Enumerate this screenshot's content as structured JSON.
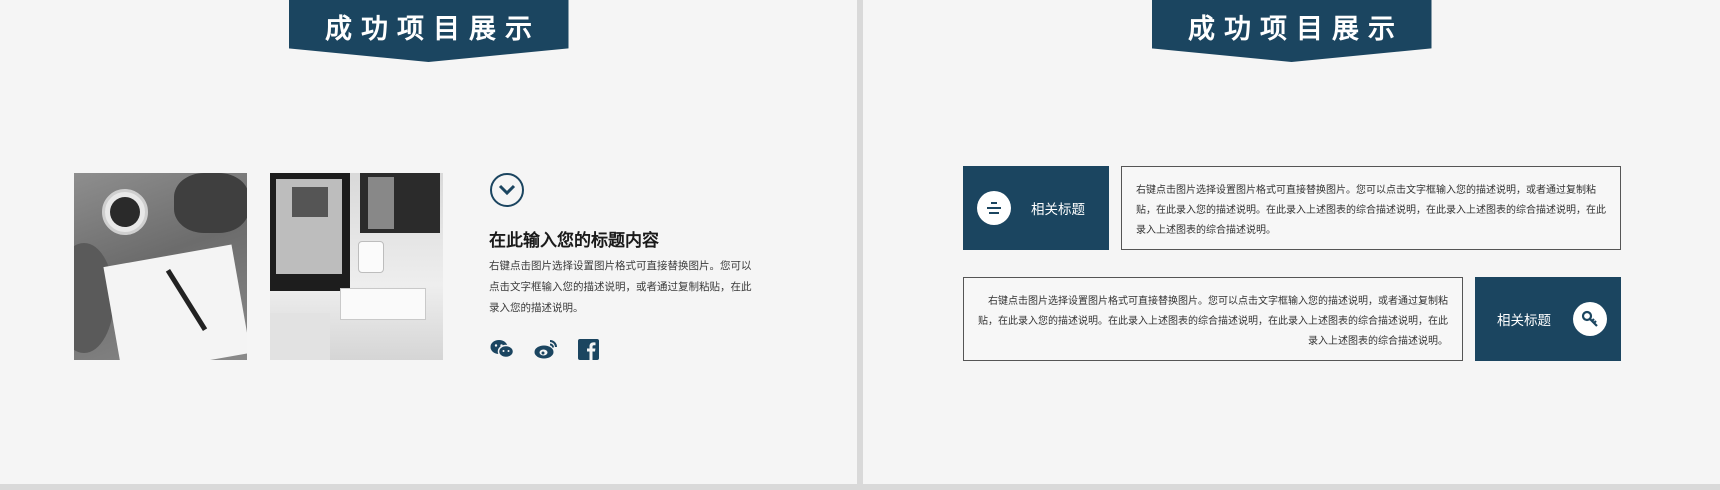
{
  "slides": {
    "left": {
      "banner_title": "成功项目展示",
      "heading": "在此输入您的标题内容",
      "paragraph": "右键点击图片选择设置图片格式可直接替换图片。您可以点击文字框输入您的描述说明，或者通过复制粘贴，在此录入您的描述说明。",
      "social_icons": [
        "wechat-icon",
        "weibo-icon",
        "facebook-icon"
      ]
    },
    "right": {
      "banner_title": "成功项目展示",
      "card1": {
        "label": "相关标题",
        "icon": "align-center-icon",
        "text": "右键点击图片选择设置图片格式可直接替换图片。您可以点击文字框输入您的描述说明，或者通过复制粘贴，在此录入您的描述说明。在此录入上述图表的综合描述说明，在此录入上述图表的综合描述说明，在此录入上述图表的综合描述说明。"
      },
      "card2": {
        "label": "相关标题",
        "icon": "key-icon",
        "text": "右键点击图片选择设置图片格式可直接替换图片。您可以点击文字框输入您的描述说明，或者通过复制粘贴，在此录入您的描述说明。在此录入上述图表的综合描述说明，在此录入上述图表的综合描述说明，在此录入上述图表的综合描述说明。"
      }
    }
  },
  "colors": {
    "accent": "#1b4560",
    "background": "#f5f5f5"
  }
}
